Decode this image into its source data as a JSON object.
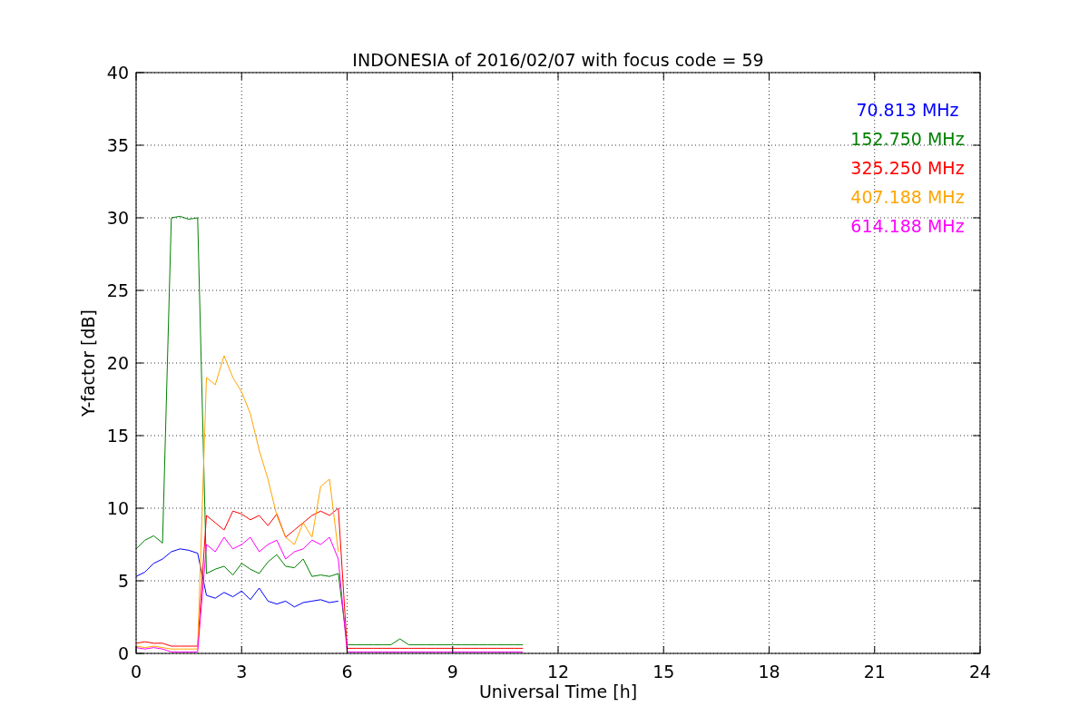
{
  "chart": {
    "chart_data": {
      "type": "line",
      "title": "INDONESIA of 2016/02/07 with focus code = 59",
      "xlabel": "Universal Time [h]",
      "ylabel": "Y-factor [dB]",
      "grid": true,
      "x": [
        0,
        0.25,
        0.5,
        0.75,
        1,
        1.25,
        1.5,
        1.75,
        2,
        2.25,
        2.5,
        2.75,
        3,
        3.25,
        3.5,
        3.75,
        4,
        4.25,
        4.5,
        4.75,
        5,
        5.25,
        5.5,
        5.75,
        6,
        6.25,
        6.5,
        6.75,
        7,
        7.25,
        7.5,
        7.75,
        8,
        8.25,
        8.5,
        8.75,
        9,
        9.25,
        9.5,
        9.75,
        10,
        10.25,
        10.5,
        10.75,
        11
      ],
      "series": [
        {
          "name": "70.813 MHz",
          "color": "#0000ff",
          "values": [
            5.3,
            5.6,
            6.2,
            6.5,
            7,
            7.2,
            7.1,
            6.9,
            4,
            3.8,
            4.2,
            3.9,
            4.3,
            3.7,
            4.5,
            3.6,
            3.4,
            3.6,
            3.2,
            3.5,
            3.6,
            3.7,
            3.5,
            3.6,
            null,
            null,
            null,
            null,
            null,
            null,
            null,
            null,
            null,
            null,
            null,
            null,
            null,
            null,
            null,
            null,
            null,
            null,
            null,
            null,
            null
          ]
        },
        {
          "name": "152.750 MHz",
          "color": "#008000",
          "values": [
            7.2,
            7.8,
            8.1,
            7.6,
            30,
            30.1,
            29.9,
            30,
            5.5,
            5.8,
            6,
            5.4,
            6.2,
            5.8,
            5.5,
            6.3,
            6.8,
            6,
            5.9,
            6.5,
            5.3,
            5.4,
            5.3,
            5.5,
            0.6,
            0.6,
            0.6,
            0.6,
            0.6,
            0.6,
            1,
            0.6,
            0.6,
            0.6,
            0.6,
            0.6,
            0.6,
            0.6,
            0.6,
            0.6,
            0.6,
            0.6,
            0.6,
            0.6,
            0.6
          ]
        },
        {
          "name": "325.250 MHz",
          "color": "#ff0000",
          "values": [
            0.7,
            0.8,
            0.7,
            0.7,
            0.5,
            0.5,
            0.5,
            0.5,
            9.5,
            9,
            8.5,
            9.8,
            9.6,
            9.2,
            9.5,
            8.8,
            9.6,
            8,
            8.5,
            9,
            9.5,
            9.8,
            9.5,
            10,
            0.35,
            0.35,
            0.35,
            0.35,
            0.35,
            0.35,
            0.35,
            0.35,
            0.35,
            0.35,
            0.35,
            0.35,
            0.35,
            0.35,
            0.35,
            0.35,
            0.35,
            0.35,
            0.35,
            0.35,
            0.35
          ]
        },
        {
          "name": "407.188 MHz",
          "color": "#ffa500",
          "values": [
            0.5,
            0.4,
            0.5,
            0.4,
            0.3,
            0.3,
            0.3,
            0.3,
            19,
            18.5,
            20.5,
            19,
            18,
            16.5,
            14,
            12,
            9.5,
            8,
            7.5,
            9,
            8,
            11.5,
            12,
            7,
            null,
            null,
            null,
            null,
            null,
            null,
            null,
            null,
            null,
            null,
            null,
            null,
            null,
            null,
            null,
            null,
            null,
            null,
            null,
            null,
            null
          ]
        },
        {
          "name": "614.188 MHz",
          "color": "#ff00ff",
          "values": [
            0.4,
            0.3,
            0.4,
            0.3,
            0.1,
            0.1,
            0.1,
            0.1,
            7.5,
            7,
            8,
            7.2,
            7.5,
            8,
            7,
            7.5,
            7.8,
            6.5,
            7,
            7.2,
            7.8,
            7.5,
            8,
            6.5,
            0.1,
            0.1,
            0.1,
            0.1,
            0.1,
            0.1,
            0.1,
            0.1,
            0.1,
            0.1,
            0.1,
            0.1,
            0.1,
            0.1,
            0.1,
            0.1,
            0.1,
            0.1,
            0.1,
            0.1,
            0.1
          ]
        }
      ],
      "xlim": [
        0,
        24
      ],
      "ylim": [
        0,
        40
      ],
      "xticks": [
        0,
        3,
        6,
        9,
        12,
        15,
        18,
        21,
        24
      ],
      "yticks": [
        0,
        5,
        10,
        15,
        20,
        25,
        30,
        35,
        40
      ]
    }
  }
}
